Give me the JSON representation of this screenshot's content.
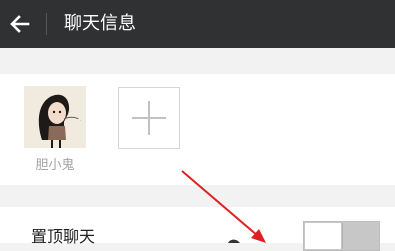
{
  "header": {
    "back_icon": "back-arrow-icon",
    "title": "聊天信息"
  },
  "members": [
    {
      "name": "胆小鬼"
    }
  ],
  "add_member_icon": "plus-icon",
  "settings": {
    "pin_label": "置顶聊天",
    "pin_enabled": false
  },
  "colors": {
    "titlebar": "#2f3133",
    "annotation": "#e02020"
  }
}
